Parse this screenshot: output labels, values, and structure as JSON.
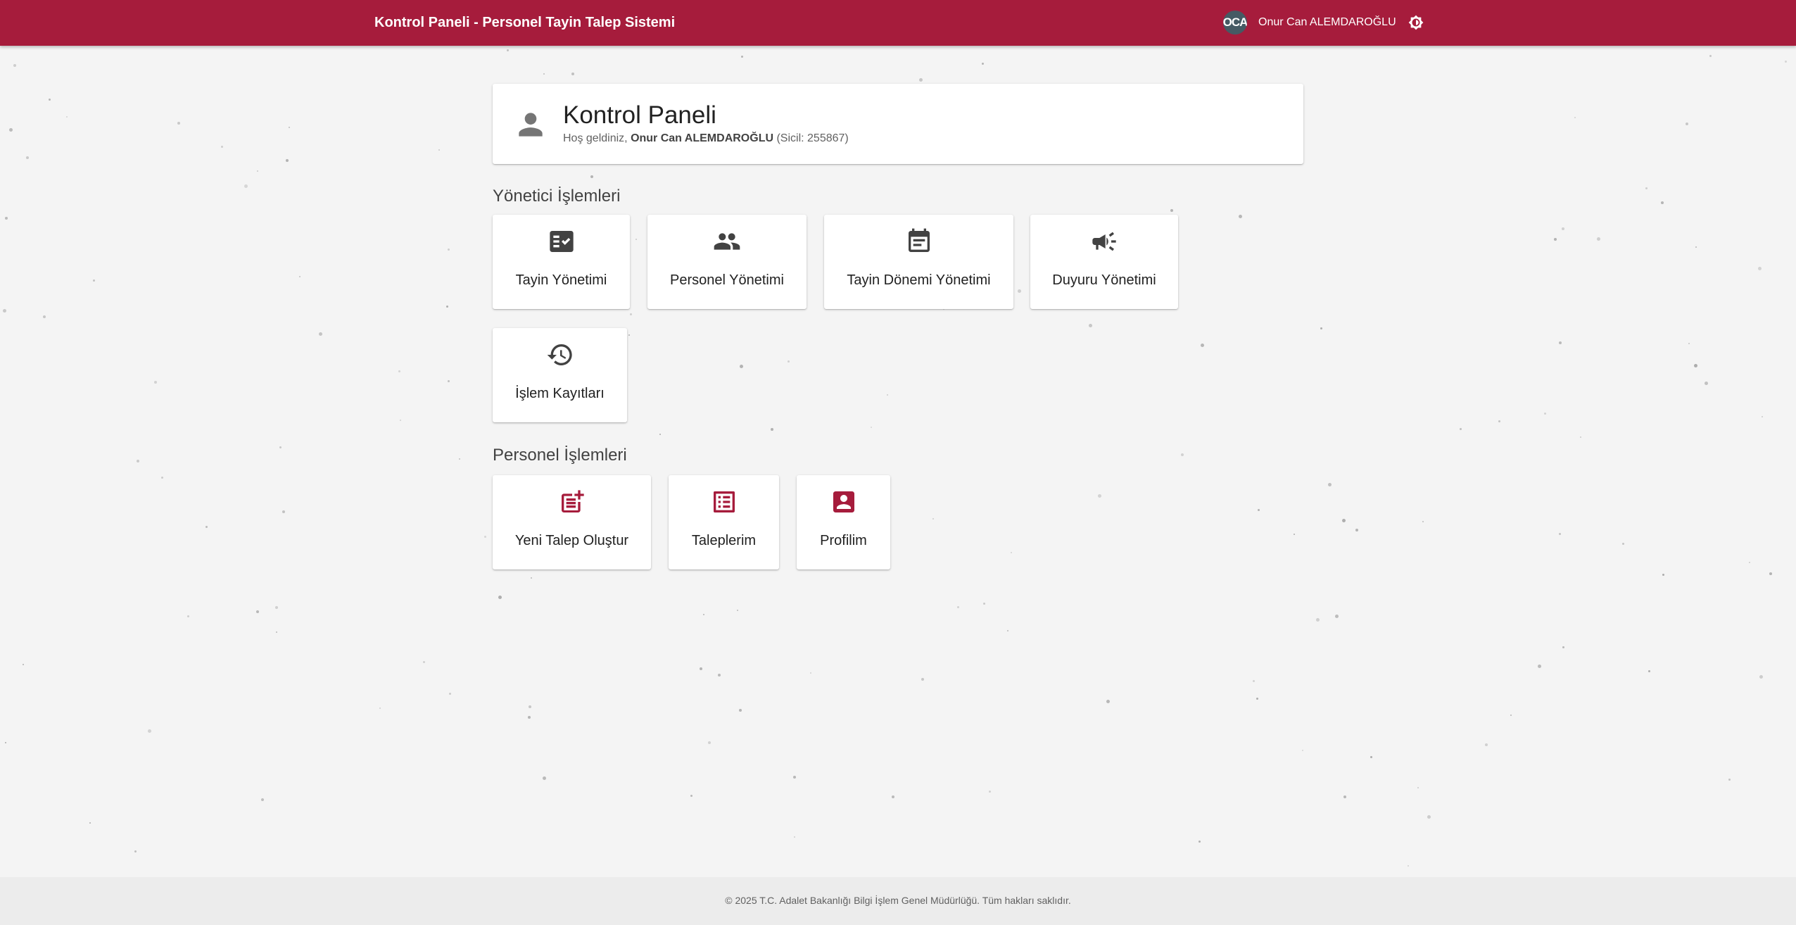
{
  "header": {
    "title": "Kontrol Paneli - Personel Tayin Talep Sistemi",
    "avatar_initials": "OCA",
    "user_name": "Onur Can ALEMDAROĞLU",
    "theme_icon": "brightness-icon",
    "brand_color": "#a61c3c"
  },
  "welcome": {
    "title": "Kontrol Paneli",
    "greeting": "Hoş geldiniz,",
    "user_name": "Onur Can ALEMDAROĞLU",
    "sicil": "(Sicil: 255867)",
    "icon": "person-icon"
  },
  "admin_section": {
    "title": "Yönetici İşlemleri",
    "tiles": [
      {
        "label": "Tayin Yönetimi",
        "icon": "fact-check-icon"
      },
      {
        "label": "Personel Yönetimi",
        "icon": "people-icon"
      },
      {
        "label": "Tayin Dönemi Yönetimi",
        "icon": "event-note-icon"
      },
      {
        "label": "Duyuru Yönetimi",
        "icon": "campaign-icon"
      },
      {
        "label": "İşlem Kayıtları",
        "icon": "history-icon"
      }
    ],
    "icon_color": "#424242"
  },
  "personnel_section": {
    "title": "Personel İşlemleri",
    "tiles": [
      {
        "label": "Yeni Talep Oluştur",
        "icon": "post-add-icon"
      },
      {
        "label": "Taleplerim",
        "icon": "list-alt-icon"
      },
      {
        "label": "Profilim",
        "icon": "account-box-icon"
      }
    ],
    "icon_color": "#a61c3c"
  },
  "footer": {
    "text": "© 2025 T.C. Adalet Bakanlığı Bilgi İşlem Genel Müdürlüğü. Tüm hakları saklıdır."
  }
}
